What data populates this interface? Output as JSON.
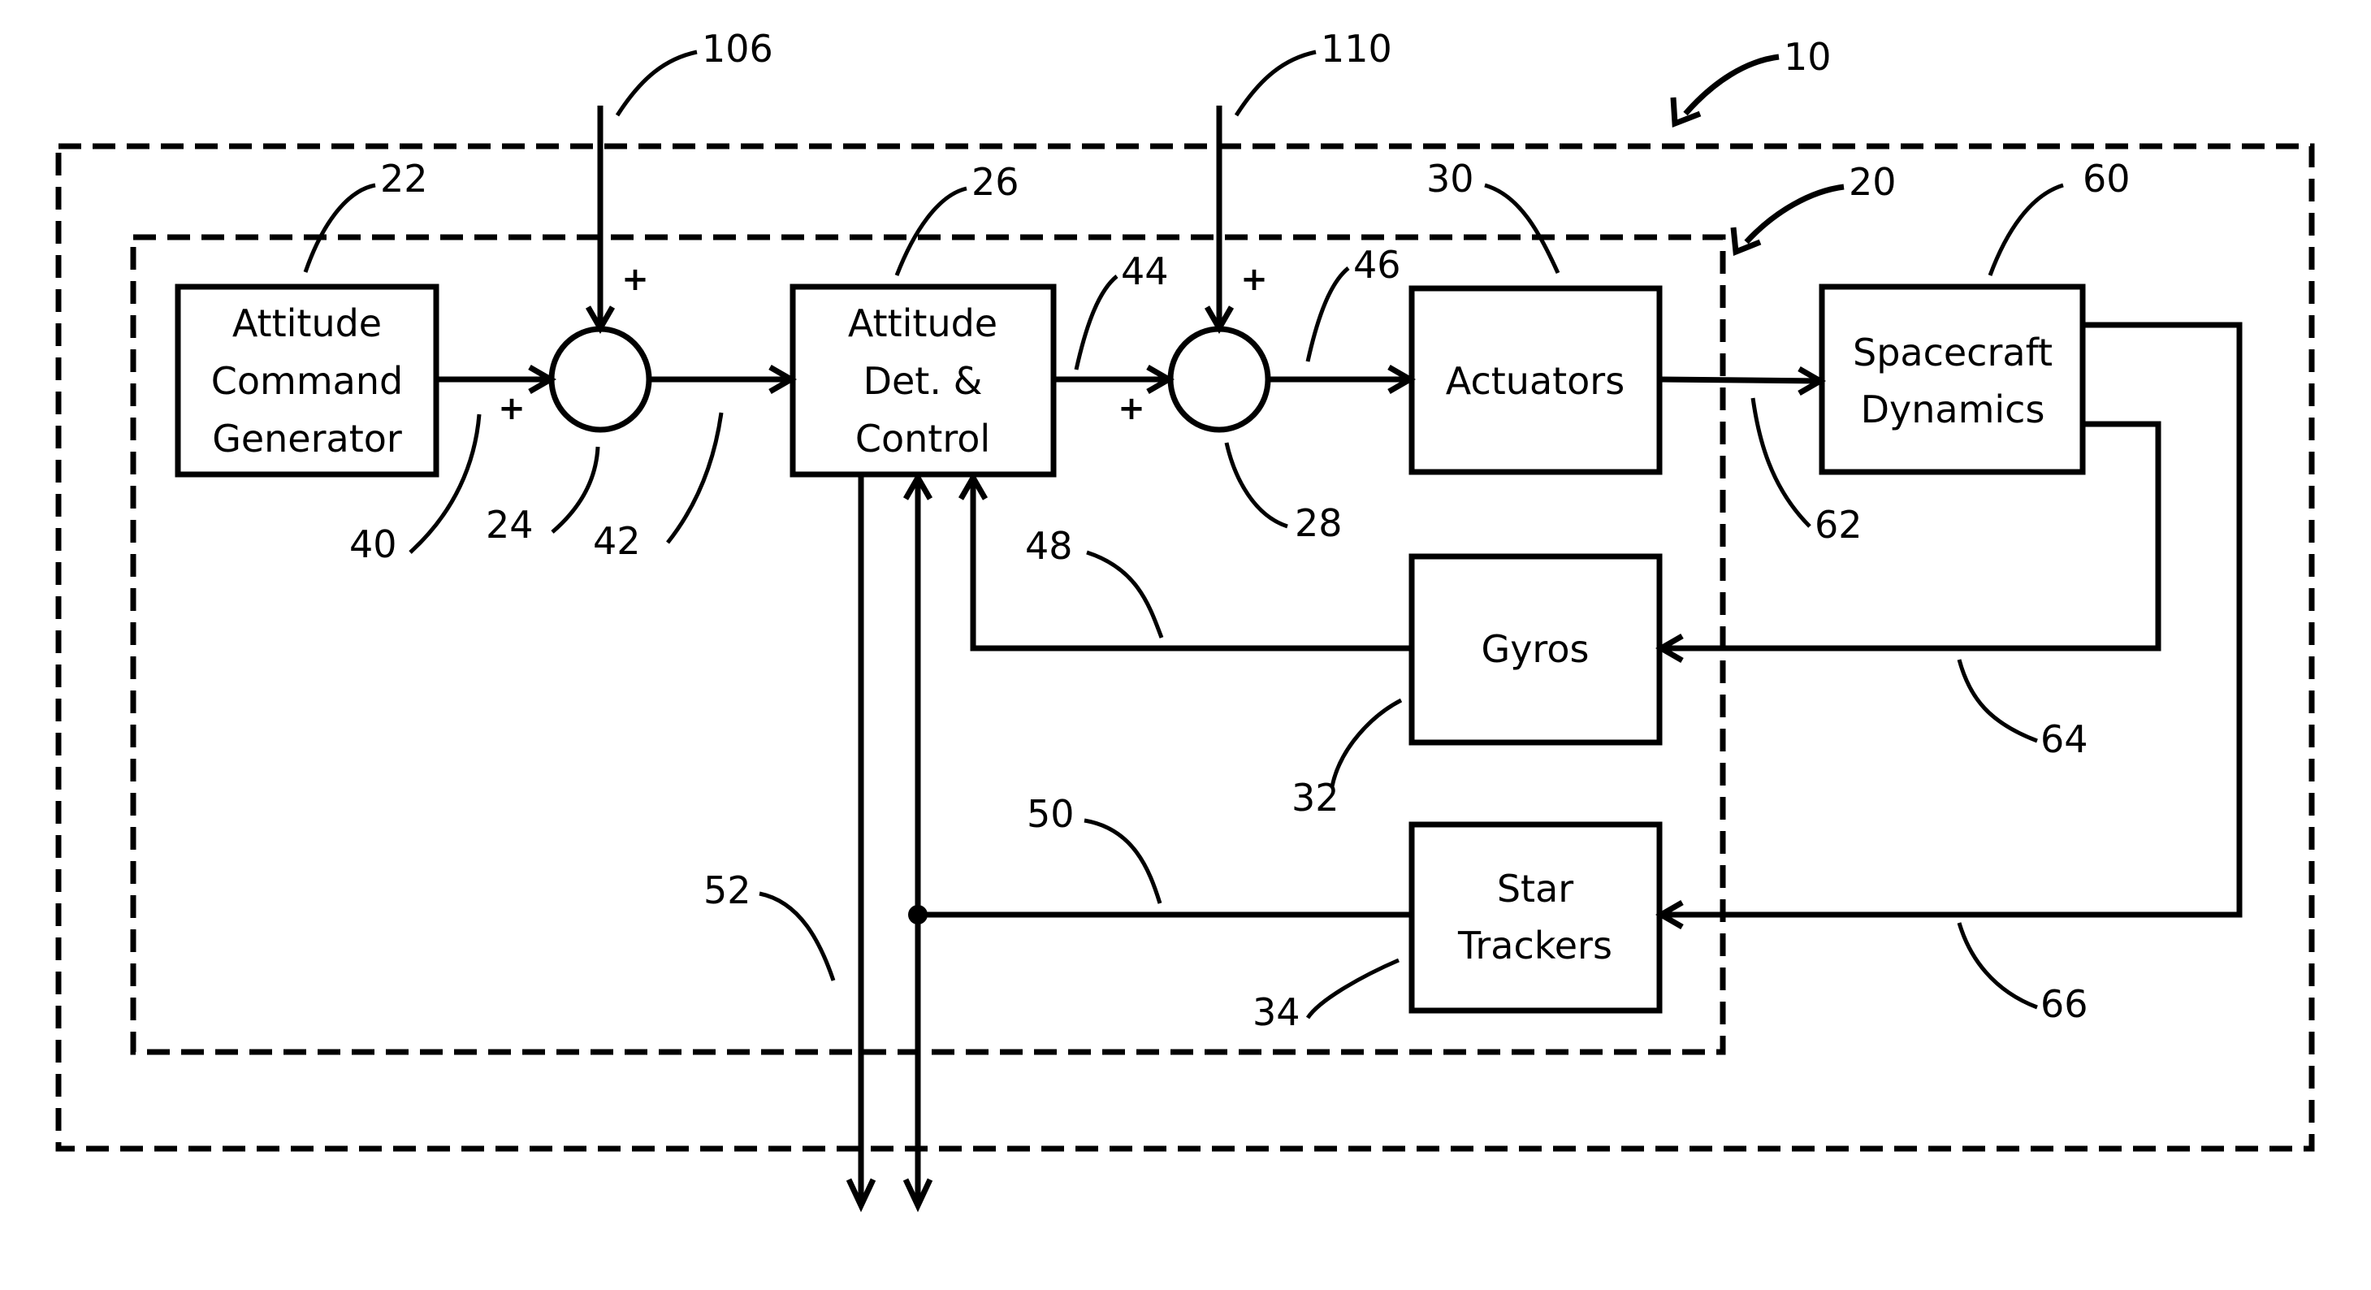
{
  "diagram": {
    "type": "block-diagram",
    "reference_numerals": {
      "system": "10",
      "inner_system": "20",
      "attitude_command_generator": "22",
      "summing_junction_1": "24",
      "attitude_det_control": "26",
      "summing_junction_2": "28",
      "actuators": "30",
      "gyros": "32",
      "star_trackers": "34",
      "signal_40": "40",
      "signal_42": "42",
      "signal_44": "44",
      "signal_46": "46",
      "signal_48": "48",
      "signal_50": "50",
      "signal_52": "52",
      "spacecraft_dynamics": "60",
      "signal_62": "62",
      "signal_64": "64",
      "signal_66": "66",
      "input_106": "106",
      "input_110": "110"
    },
    "blocks": {
      "acg": [
        "Attitude",
        "Command",
        "Generator"
      ],
      "adc": [
        "Attitude",
        "Det. &",
        "Control"
      ],
      "actuators": [
        "Actuators"
      ],
      "spacecraft": [
        "Spacecraft",
        "Dynamics"
      ],
      "gyros": [
        "Gyros"
      ],
      "star_trackers": [
        "Star",
        "Trackers"
      ]
    },
    "signs": {
      "sum1_top": "+",
      "sum1_left": "+",
      "sum2_top": "+",
      "sum2_left": "+"
    }
  }
}
